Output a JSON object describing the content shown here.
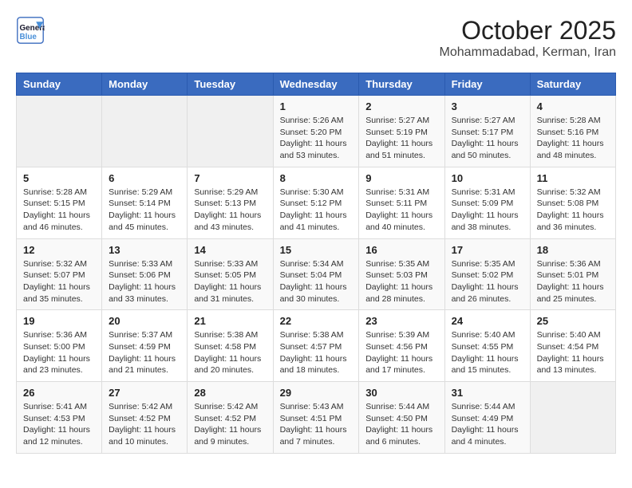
{
  "header": {
    "logo_line1": "General",
    "logo_line2": "Blue",
    "month": "October 2025",
    "location": "Mohammadabad, Kerman, Iran"
  },
  "weekdays": [
    "Sunday",
    "Monday",
    "Tuesday",
    "Wednesday",
    "Thursday",
    "Friday",
    "Saturday"
  ],
  "weeks": [
    [
      {
        "day": "",
        "info": ""
      },
      {
        "day": "",
        "info": ""
      },
      {
        "day": "",
        "info": ""
      },
      {
        "day": "1",
        "info": "Sunrise: 5:26 AM\nSunset: 5:20 PM\nDaylight: 11 hours and 53 minutes."
      },
      {
        "day": "2",
        "info": "Sunrise: 5:27 AM\nSunset: 5:19 PM\nDaylight: 11 hours and 51 minutes."
      },
      {
        "day": "3",
        "info": "Sunrise: 5:27 AM\nSunset: 5:17 PM\nDaylight: 11 hours and 50 minutes."
      },
      {
        "day": "4",
        "info": "Sunrise: 5:28 AM\nSunset: 5:16 PM\nDaylight: 11 hours and 48 minutes."
      }
    ],
    [
      {
        "day": "5",
        "info": "Sunrise: 5:28 AM\nSunset: 5:15 PM\nDaylight: 11 hours and 46 minutes."
      },
      {
        "day": "6",
        "info": "Sunrise: 5:29 AM\nSunset: 5:14 PM\nDaylight: 11 hours and 45 minutes."
      },
      {
        "day": "7",
        "info": "Sunrise: 5:29 AM\nSunset: 5:13 PM\nDaylight: 11 hours and 43 minutes."
      },
      {
        "day": "8",
        "info": "Sunrise: 5:30 AM\nSunset: 5:12 PM\nDaylight: 11 hours and 41 minutes."
      },
      {
        "day": "9",
        "info": "Sunrise: 5:31 AM\nSunset: 5:11 PM\nDaylight: 11 hours and 40 minutes."
      },
      {
        "day": "10",
        "info": "Sunrise: 5:31 AM\nSunset: 5:09 PM\nDaylight: 11 hours and 38 minutes."
      },
      {
        "day": "11",
        "info": "Sunrise: 5:32 AM\nSunset: 5:08 PM\nDaylight: 11 hours and 36 minutes."
      }
    ],
    [
      {
        "day": "12",
        "info": "Sunrise: 5:32 AM\nSunset: 5:07 PM\nDaylight: 11 hours and 35 minutes."
      },
      {
        "day": "13",
        "info": "Sunrise: 5:33 AM\nSunset: 5:06 PM\nDaylight: 11 hours and 33 minutes."
      },
      {
        "day": "14",
        "info": "Sunrise: 5:33 AM\nSunset: 5:05 PM\nDaylight: 11 hours and 31 minutes."
      },
      {
        "day": "15",
        "info": "Sunrise: 5:34 AM\nSunset: 5:04 PM\nDaylight: 11 hours and 30 minutes."
      },
      {
        "day": "16",
        "info": "Sunrise: 5:35 AM\nSunset: 5:03 PM\nDaylight: 11 hours and 28 minutes."
      },
      {
        "day": "17",
        "info": "Sunrise: 5:35 AM\nSunset: 5:02 PM\nDaylight: 11 hours and 26 minutes."
      },
      {
        "day": "18",
        "info": "Sunrise: 5:36 AM\nSunset: 5:01 PM\nDaylight: 11 hours and 25 minutes."
      }
    ],
    [
      {
        "day": "19",
        "info": "Sunrise: 5:36 AM\nSunset: 5:00 PM\nDaylight: 11 hours and 23 minutes."
      },
      {
        "day": "20",
        "info": "Sunrise: 5:37 AM\nSunset: 4:59 PM\nDaylight: 11 hours and 21 minutes."
      },
      {
        "day": "21",
        "info": "Sunrise: 5:38 AM\nSunset: 4:58 PM\nDaylight: 11 hours and 20 minutes."
      },
      {
        "day": "22",
        "info": "Sunrise: 5:38 AM\nSunset: 4:57 PM\nDaylight: 11 hours and 18 minutes."
      },
      {
        "day": "23",
        "info": "Sunrise: 5:39 AM\nSunset: 4:56 PM\nDaylight: 11 hours and 17 minutes."
      },
      {
        "day": "24",
        "info": "Sunrise: 5:40 AM\nSunset: 4:55 PM\nDaylight: 11 hours and 15 minutes."
      },
      {
        "day": "25",
        "info": "Sunrise: 5:40 AM\nSunset: 4:54 PM\nDaylight: 11 hours and 13 minutes."
      }
    ],
    [
      {
        "day": "26",
        "info": "Sunrise: 5:41 AM\nSunset: 4:53 PM\nDaylight: 11 hours and 12 minutes."
      },
      {
        "day": "27",
        "info": "Sunrise: 5:42 AM\nSunset: 4:52 PM\nDaylight: 11 hours and 10 minutes."
      },
      {
        "day": "28",
        "info": "Sunrise: 5:42 AM\nSunset: 4:52 PM\nDaylight: 11 hours and 9 minutes."
      },
      {
        "day": "29",
        "info": "Sunrise: 5:43 AM\nSunset: 4:51 PM\nDaylight: 11 hours and 7 minutes."
      },
      {
        "day": "30",
        "info": "Sunrise: 5:44 AM\nSunset: 4:50 PM\nDaylight: 11 hours and 6 minutes."
      },
      {
        "day": "31",
        "info": "Sunrise: 5:44 AM\nSunset: 4:49 PM\nDaylight: 11 hours and 4 minutes."
      },
      {
        "day": "",
        "info": ""
      }
    ]
  ]
}
